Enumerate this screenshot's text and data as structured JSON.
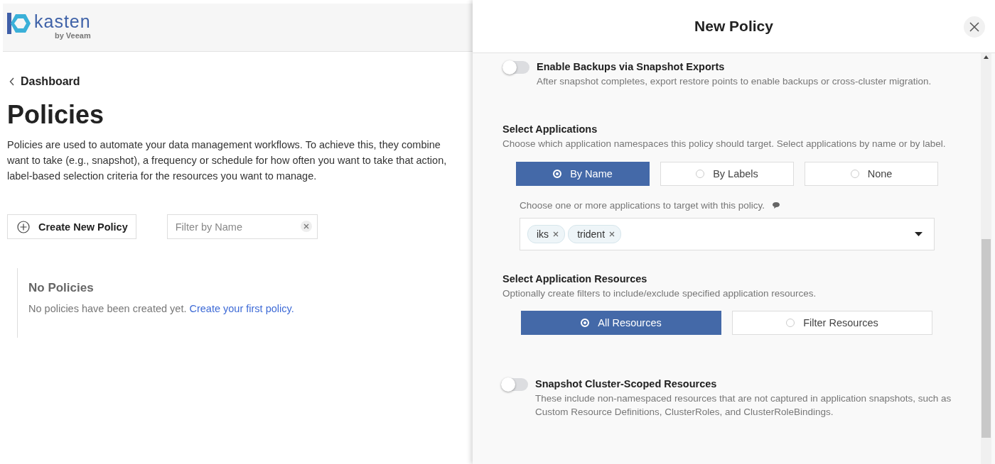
{
  "logo": {
    "name": "kasten",
    "tagline": "by Veeam"
  },
  "breadcrumb": {
    "label": "Dashboard"
  },
  "page": {
    "title": "Policies",
    "description_lines": [
      "Policies are used to automate your data management workflows. To achieve this, they combine",
      "want to take (e.g., snapshot), a frequency or schedule for how often you want to take that action,",
      "label-based selection criteria for the resources you want to manage."
    ]
  },
  "toolbar": {
    "create_button": "Create New Policy",
    "filter": {
      "placeholder": "Filter by Name"
    }
  },
  "empty_state": {
    "title": "No Policies",
    "text": "No policies have been created yet.",
    "link": "Create your first policy."
  },
  "panel": {
    "title": "New Policy",
    "backups_toggle": {
      "label": "Enable Backups via Snapshot Exports",
      "description": "After snapshot completes, export restore points to enable backups or cross-cluster migration.",
      "on": false
    },
    "applications": {
      "title": "Select Applications",
      "description": "Choose which application namespaces this policy should target. Select applications by name or by label.",
      "options": [
        {
          "label": "By Name",
          "selected": true
        },
        {
          "label": "By Labels",
          "selected": false
        },
        {
          "label": "None",
          "selected": false
        }
      ],
      "hint": "Choose one or more applications to target with this policy.",
      "selected_tags": [
        "iks",
        "trident"
      ]
    },
    "resources": {
      "title": "Select Application Resources",
      "description": "Optionally create filters to include/exclude specified application resources.",
      "options": [
        {
          "label": "All Resources",
          "selected": true
        },
        {
          "label": "Filter Resources",
          "selected": false
        }
      ]
    },
    "cluster_toggle": {
      "label": "Snapshot Cluster-Scoped Resources",
      "description": "These include non-namespaced resources that are not captured in application snapshots, such as Custom Resource Definitions, ClusterRoles, and ClusterRoleBindings.",
      "on": false
    }
  }
}
